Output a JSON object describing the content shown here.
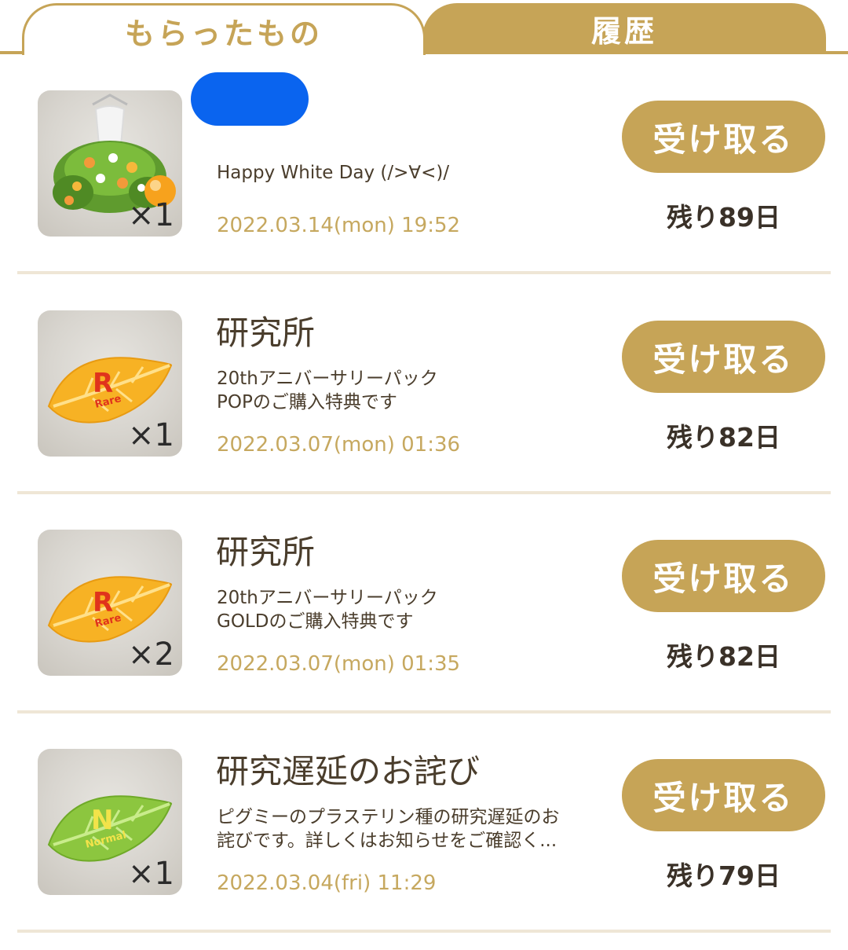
{
  "tabs": {
    "received": "もらったもの",
    "history": "履歴"
  },
  "items": [
    {
      "title": "",
      "description": "Happy White Day (/>∀<)/",
      "date": "2022.03.14(mon) 19:52",
      "quantity": "×1",
      "button": "受け取る",
      "remaining": "残り89日",
      "icon": "dress-icon"
    },
    {
      "title": "研究所",
      "description": "20thアニバーサリーパック\nPOPのご購入特典です",
      "date": "2022.03.07(mon) 01:36",
      "quantity": "×1",
      "button": "受け取る",
      "remaining": "残り82日",
      "icon": "rare-leaf-icon",
      "leaf_letter": "R",
      "leaf_label": "Rare"
    },
    {
      "title": "研究所",
      "description": "20thアニバーサリーパック\nGOLDのご購入特典です",
      "date": "2022.03.07(mon) 01:35",
      "quantity": "×2",
      "button": "受け取る",
      "remaining": "残り82日",
      "icon": "rare-leaf-icon",
      "leaf_letter": "R",
      "leaf_label": "Rare"
    },
    {
      "title": "研究遅延のお詫び",
      "description": "ピグミーのプラステリン種の研究遅延のお\n詫びです。詳しくはお知らせをご確認く...",
      "date": "2022.03.04(fri) 11:29",
      "quantity": "×1",
      "button": "受け取る",
      "remaining": "残り79日",
      "icon": "normal-leaf-icon",
      "leaf_letter": "N",
      "leaf_label": "Normal"
    }
  ],
  "colors": {
    "accent": "#c6a457",
    "date_text": "#c6a85f",
    "divider": "#efe6d6",
    "rare_leaf": "#f7b224",
    "normal_leaf": "#8cc63f",
    "redaction": "#0a64ef"
  }
}
